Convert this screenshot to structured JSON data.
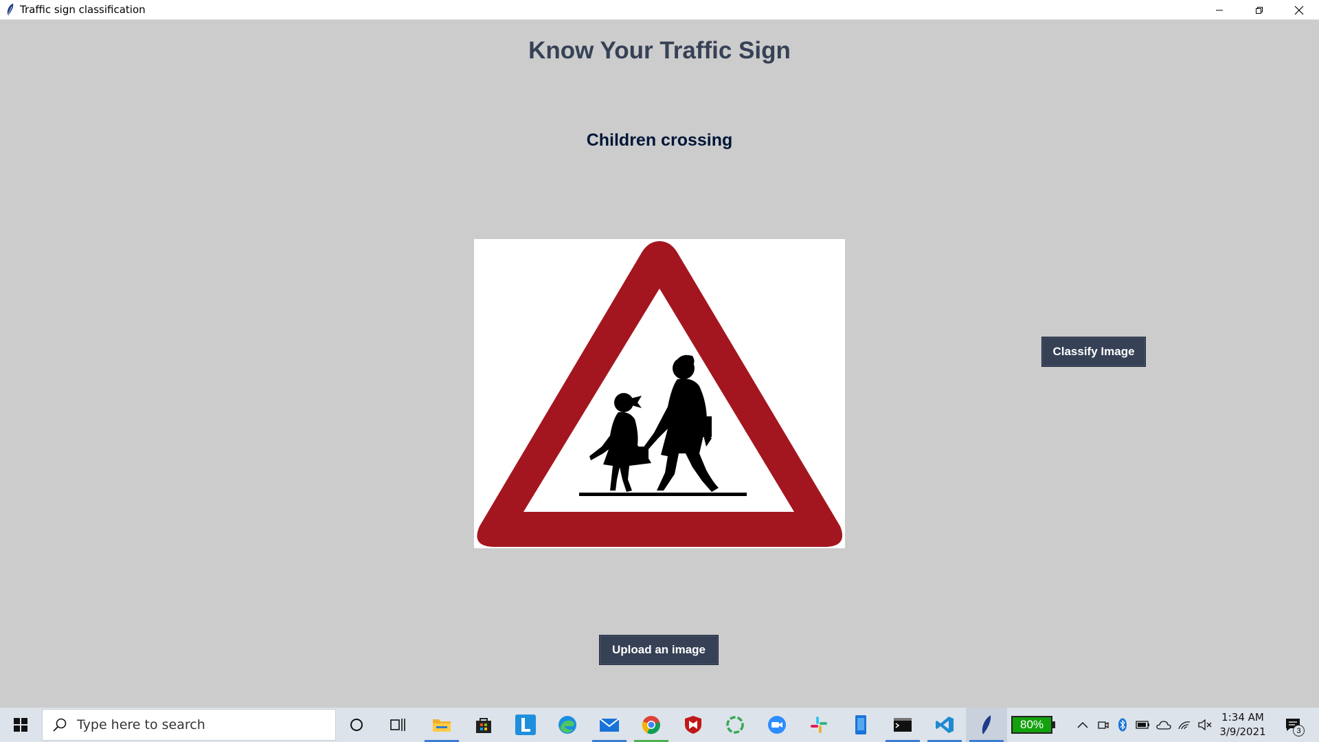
{
  "window": {
    "title": "Traffic sign classification",
    "app_icon": "feather-icon",
    "controls": [
      "minimize-icon",
      "restore-icon",
      "close-icon"
    ]
  },
  "app": {
    "heading": "Know Your Traffic Sign",
    "result_label": "Children crossing",
    "image": "children-crossing-sign",
    "classify_button": "Classify Image",
    "upload_button": "Upload an image",
    "colors": {
      "background": "#cccccc",
      "heading": "#364156",
      "result": "#011638",
      "button_bg": "#364156",
      "button_fg": "#ffffff"
    }
  },
  "taskbar": {
    "search_placeholder": "Type here to search",
    "pinned": [
      "cortana-icon",
      "task-view-icon",
      "file-explorer-icon",
      "store-icon",
      "l-app-icon",
      "edge-icon",
      "mail-icon",
      "chrome-icon",
      "mcafee-icon",
      "sync-icon",
      "zoom-icon",
      "slack-icon",
      "phone-icon",
      "terminal-icon",
      "vscode-icon",
      "feather-app-icon"
    ],
    "battery_percent": "80%",
    "tray": [
      "chevron-up-icon",
      "meet-now-icon",
      "bluetooth-icon",
      "battery-icon",
      "onedrive-icon",
      "wifi-icon",
      "mute-icon"
    ],
    "time": "1:34 AM",
    "date": "3/9/2021",
    "notifications": "3"
  }
}
